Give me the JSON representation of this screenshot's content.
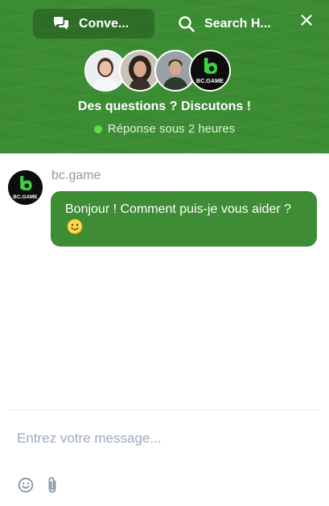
{
  "header": {
    "tabs": [
      {
        "label": "Conve...",
        "icon": "chat-bubbles-icon",
        "active": true
      },
      {
        "label": "Search H...",
        "icon": "search-icon",
        "active": false
      }
    ],
    "close_icon": "close-icon",
    "avatars": [
      {
        "name": "agent-woman-1"
      },
      {
        "name": "agent-woman-2"
      },
      {
        "name": "agent-man"
      },
      {
        "name": "bc-game-logo",
        "label": "BC.GAME"
      }
    ],
    "headline": "Des questions ? Discutons !",
    "status": "Réponse sous 2 heures",
    "status_color": "#5fdc4a",
    "background_color": "#3b8c32"
  },
  "conversation": {
    "messages": [
      {
        "sender": "bc.game",
        "avatar_label": "BC.GAME",
        "text": "Bonjour ! Comment puis-je vous aider ?",
        "emoji": "slightly-smiling-face",
        "bubble_color": "#3e8c34"
      }
    ]
  },
  "composer": {
    "placeholder": "Entrez votre message...",
    "value": "",
    "emoji_icon": "emoji-icon",
    "attach_icon": "paperclip-icon"
  }
}
